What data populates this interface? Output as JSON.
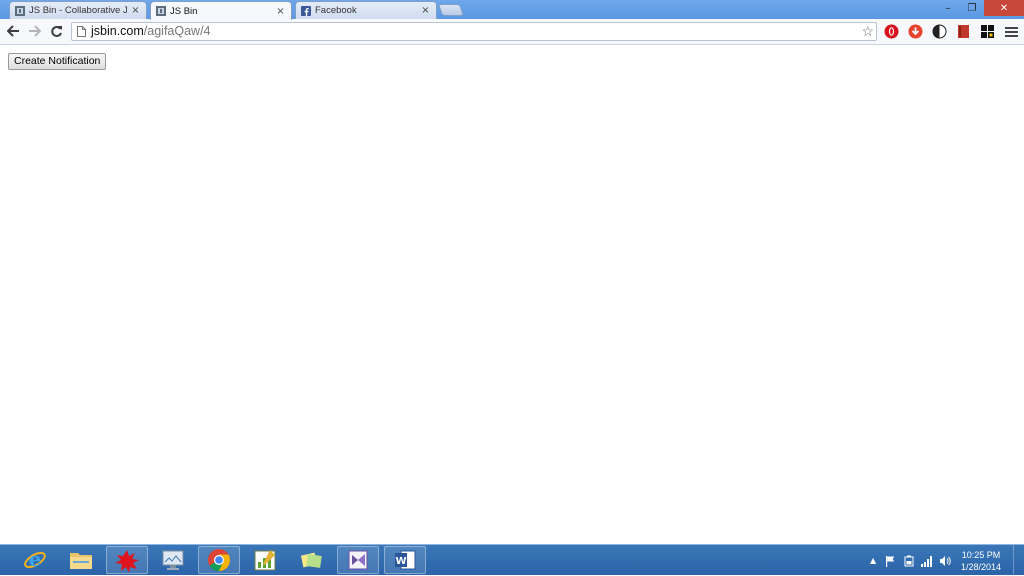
{
  "browser": {
    "tabs": [
      {
        "title": "JS Bin - Collaborative Java",
        "favicon": "jsbin-icon",
        "active": false
      },
      {
        "title": "JS Bin",
        "favicon": "jsbin-icon",
        "active": true
      },
      {
        "title": "Facebook",
        "favicon": "facebook-icon",
        "active": false
      }
    ],
    "close_glyph": "×",
    "window_controls": {
      "minimize": "–",
      "restore": "❐",
      "close": "✕"
    },
    "address": {
      "host": "jsbin.com",
      "path": "/agifaQaw/4"
    },
    "extensions": [
      "opera-icon",
      "download-icon",
      "contrast-icon",
      "book-icon",
      "grid-icon",
      "menu-icon"
    ]
  },
  "page": {
    "button_label": "Create Notification"
  },
  "taskbar": {
    "apps": [
      "internet-explorer-icon",
      "file-explorer-icon",
      "paint-splat-icon",
      "monitor-icon",
      "chrome-icon",
      "chart-app-icon",
      "sticky-notes-icon",
      "visual-studio-icon",
      "word-icon"
    ],
    "time": "10:25 PM",
    "date": "1/28/2014",
    "colors": {
      "taskbar": "#2b64a8",
      "close_button": "#c7473a"
    }
  }
}
